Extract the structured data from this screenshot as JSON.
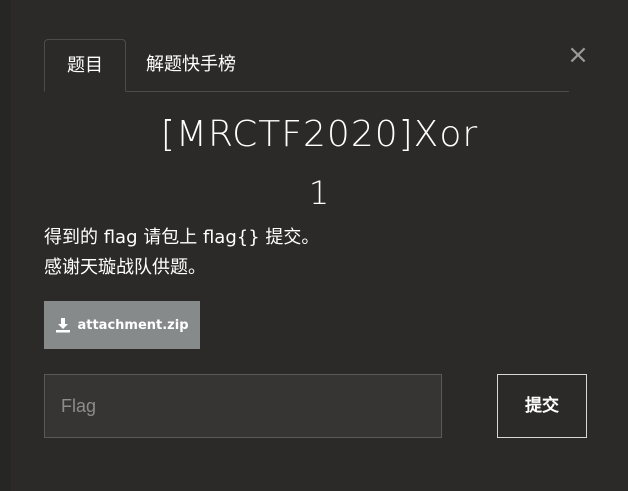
{
  "tabs": [
    {
      "label": "题目",
      "active": true
    },
    {
      "label": "解题快手榜",
      "active": false
    }
  ],
  "close_label": "×",
  "challenge": {
    "name": "[MRCTF2020]Xor",
    "points": "1",
    "description_lines": [
      "得到的 flag 请包上 flag{} 提交。",
      "感谢天璇战队供题。"
    ]
  },
  "attachment": {
    "icon": "download-icon",
    "filename": "attachment.zip"
  },
  "flag_form": {
    "placeholder": "Flag",
    "value": "",
    "submit_label": "提交"
  },
  "colors": {
    "background": "#2b2a28",
    "attachment_button": "#878a8b",
    "input_background": "#363533"
  }
}
